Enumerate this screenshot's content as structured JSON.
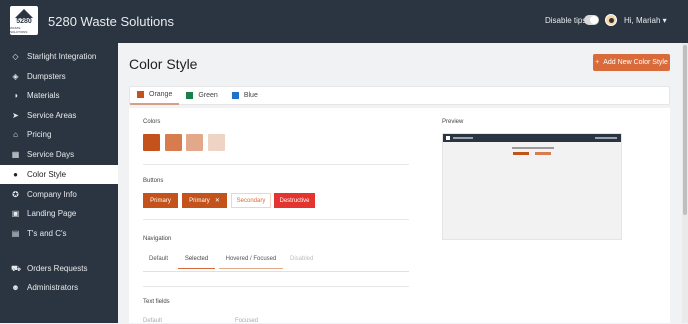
{
  "header": {
    "app_title": "5280 Waste Solutions",
    "logo_text": "5280",
    "logo_sub": "WASTE SOLUTIONS",
    "disable_tips_label": "Disable tips",
    "greeting": "Hi, Mariah ▾"
  },
  "sidebar": {
    "items": [
      {
        "label": "Starlight Integration",
        "icon": "diamond-icon"
      },
      {
        "label": "Dumpsters",
        "icon": "layers-icon"
      },
      {
        "label": "Materials",
        "icon": "half-circle-icon"
      },
      {
        "label": "Service Areas",
        "icon": "location-arrow-icon"
      },
      {
        "label": "Pricing",
        "icon": "tag-icon"
      },
      {
        "label": "Service Days",
        "icon": "calendar-icon"
      },
      {
        "label": "Color Style",
        "icon": "palette-icon"
      },
      {
        "label": "Company Info",
        "icon": "info-icon"
      },
      {
        "label": "Landing Page",
        "icon": "page-icon"
      },
      {
        "label": "T's and C's",
        "icon": "document-icon"
      },
      {
        "label": "Orders Requests",
        "icon": "cart-icon"
      },
      {
        "label": "Administrators",
        "icon": "users-icon"
      }
    ]
  },
  "main": {
    "title": "Color Style",
    "add_button": "Add New Color Style",
    "tabs": [
      {
        "label": "Orange",
        "color": "#c4521b"
      },
      {
        "label": "Green",
        "color": "#1a7f4b"
      },
      {
        "label": "Blue",
        "color": "#1f74c9"
      }
    ],
    "colors_label": "Colors",
    "swatches": [
      "#c4521b",
      "#d87c4f",
      "#e3a78a",
      "#efd4c6"
    ],
    "buttons_label": "Buttons",
    "buttons": {
      "primary": "Primary",
      "primary_close": "Primary",
      "secondary": "Secondary",
      "destructive": "Destructive"
    },
    "navigation_label": "Navigation",
    "nav_states": [
      "Default",
      "Selected",
      "Hovered / Focused",
      "Disabled"
    ],
    "text_fields_label": "Text fields",
    "text_field_states": [
      "Default",
      "Focused"
    ],
    "preview_label": "Preview"
  },
  "colors": {
    "brand": "#c4521b",
    "sidebar_bg": "#2b3541",
    "destructive": "#e3342f"
  }
}
